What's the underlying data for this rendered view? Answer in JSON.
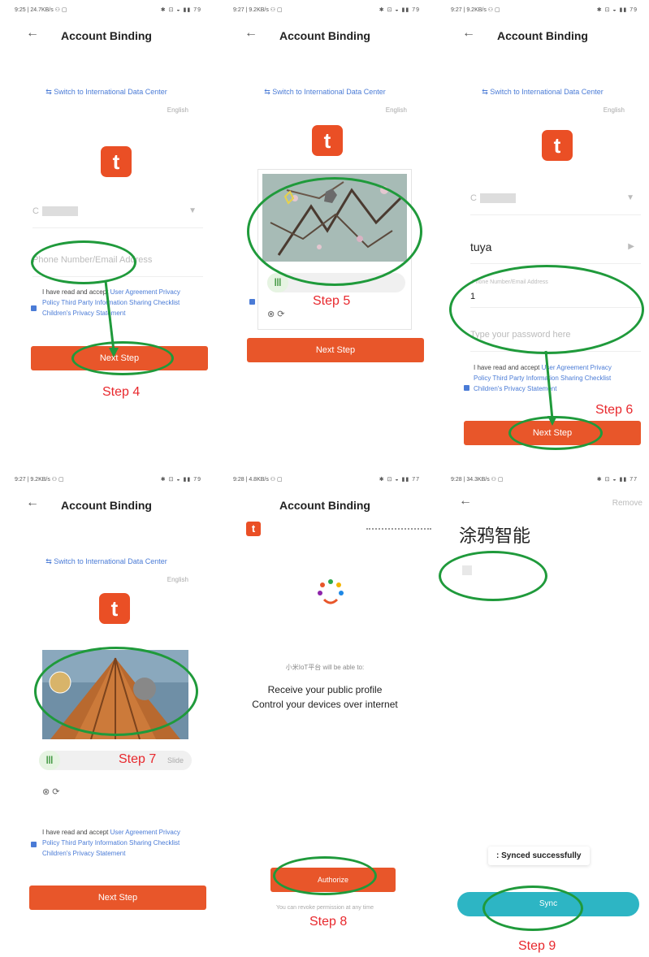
{
  "common": {
    "title": "Account Binding",
    "switch_dc": "⇆ Switch to International Data Center",
    "lang": "English",
    "agree_prefix": "I have read and accept",
    "agree_links": "User Agreement Privacy Policy Third Party Information Sharing Checklist Children's Privacy Statement",
    "next_step": "Next Step",
    "status_icons": "✱ ⊡ ◒ ▮▮ 79",
    "logo_letter": "t"
  },
  "panel1": {
    "time": "9:25 | 24.7KB/s ⚇ ▢",
    "region_value": "C",
    "phone_placeholder": "Phone Number/Email Address",
    "step_label": "Step 4"
  },
  "panel2": {
    "time": "9:27 | 9.2KB/s ⚇ ▢",
    "step_label": "Step 5"
  },
  "panel3": {
    "time": "9:27 | 9.2KB/s ⚇ ▢",
    "region_value": "C",
    "account_type": "tuya",
    "phone_label": "Phone Number/Email Address",
    "phone_value": "1",
    "password_placeholder": "Type your password here",
    "step_label": "Step 6"
  },
  "panel4": {
    "time": "9:27 | 9.2KB/s ⚇ ▢",
    "slider_text": "Slide",
    "step_label": "Step 7"
  },
  "panel5": {
    "time": "9:28 | 4.8KB/s ⚇ ▢",
    "status_icons": "✱ ⊡ ◒ ▮▮ 77",
    "platform_text": "小米IoT平台 will be able to:",
    "perm1": "Receive your public profile",
    "perm2": "Control your devices over internet",
    "authorize": "Authorize",
    "revoke_note": "You can revoke permission at any time",
    "step_label": "Step 8"
  },
  "panel6": {
    "time": "9:28 | 34.3KB/s ⚇ ▢",
    "status_icons": "✱ ⊡ ◒ ▮▮ 77",
    "remove": "Remove",
    "brand_title": "涂鸦智能",
    "toast": ": Synced successfully",
    "sync": "Sync",
    "step_label": "Step 9"
  }
}
